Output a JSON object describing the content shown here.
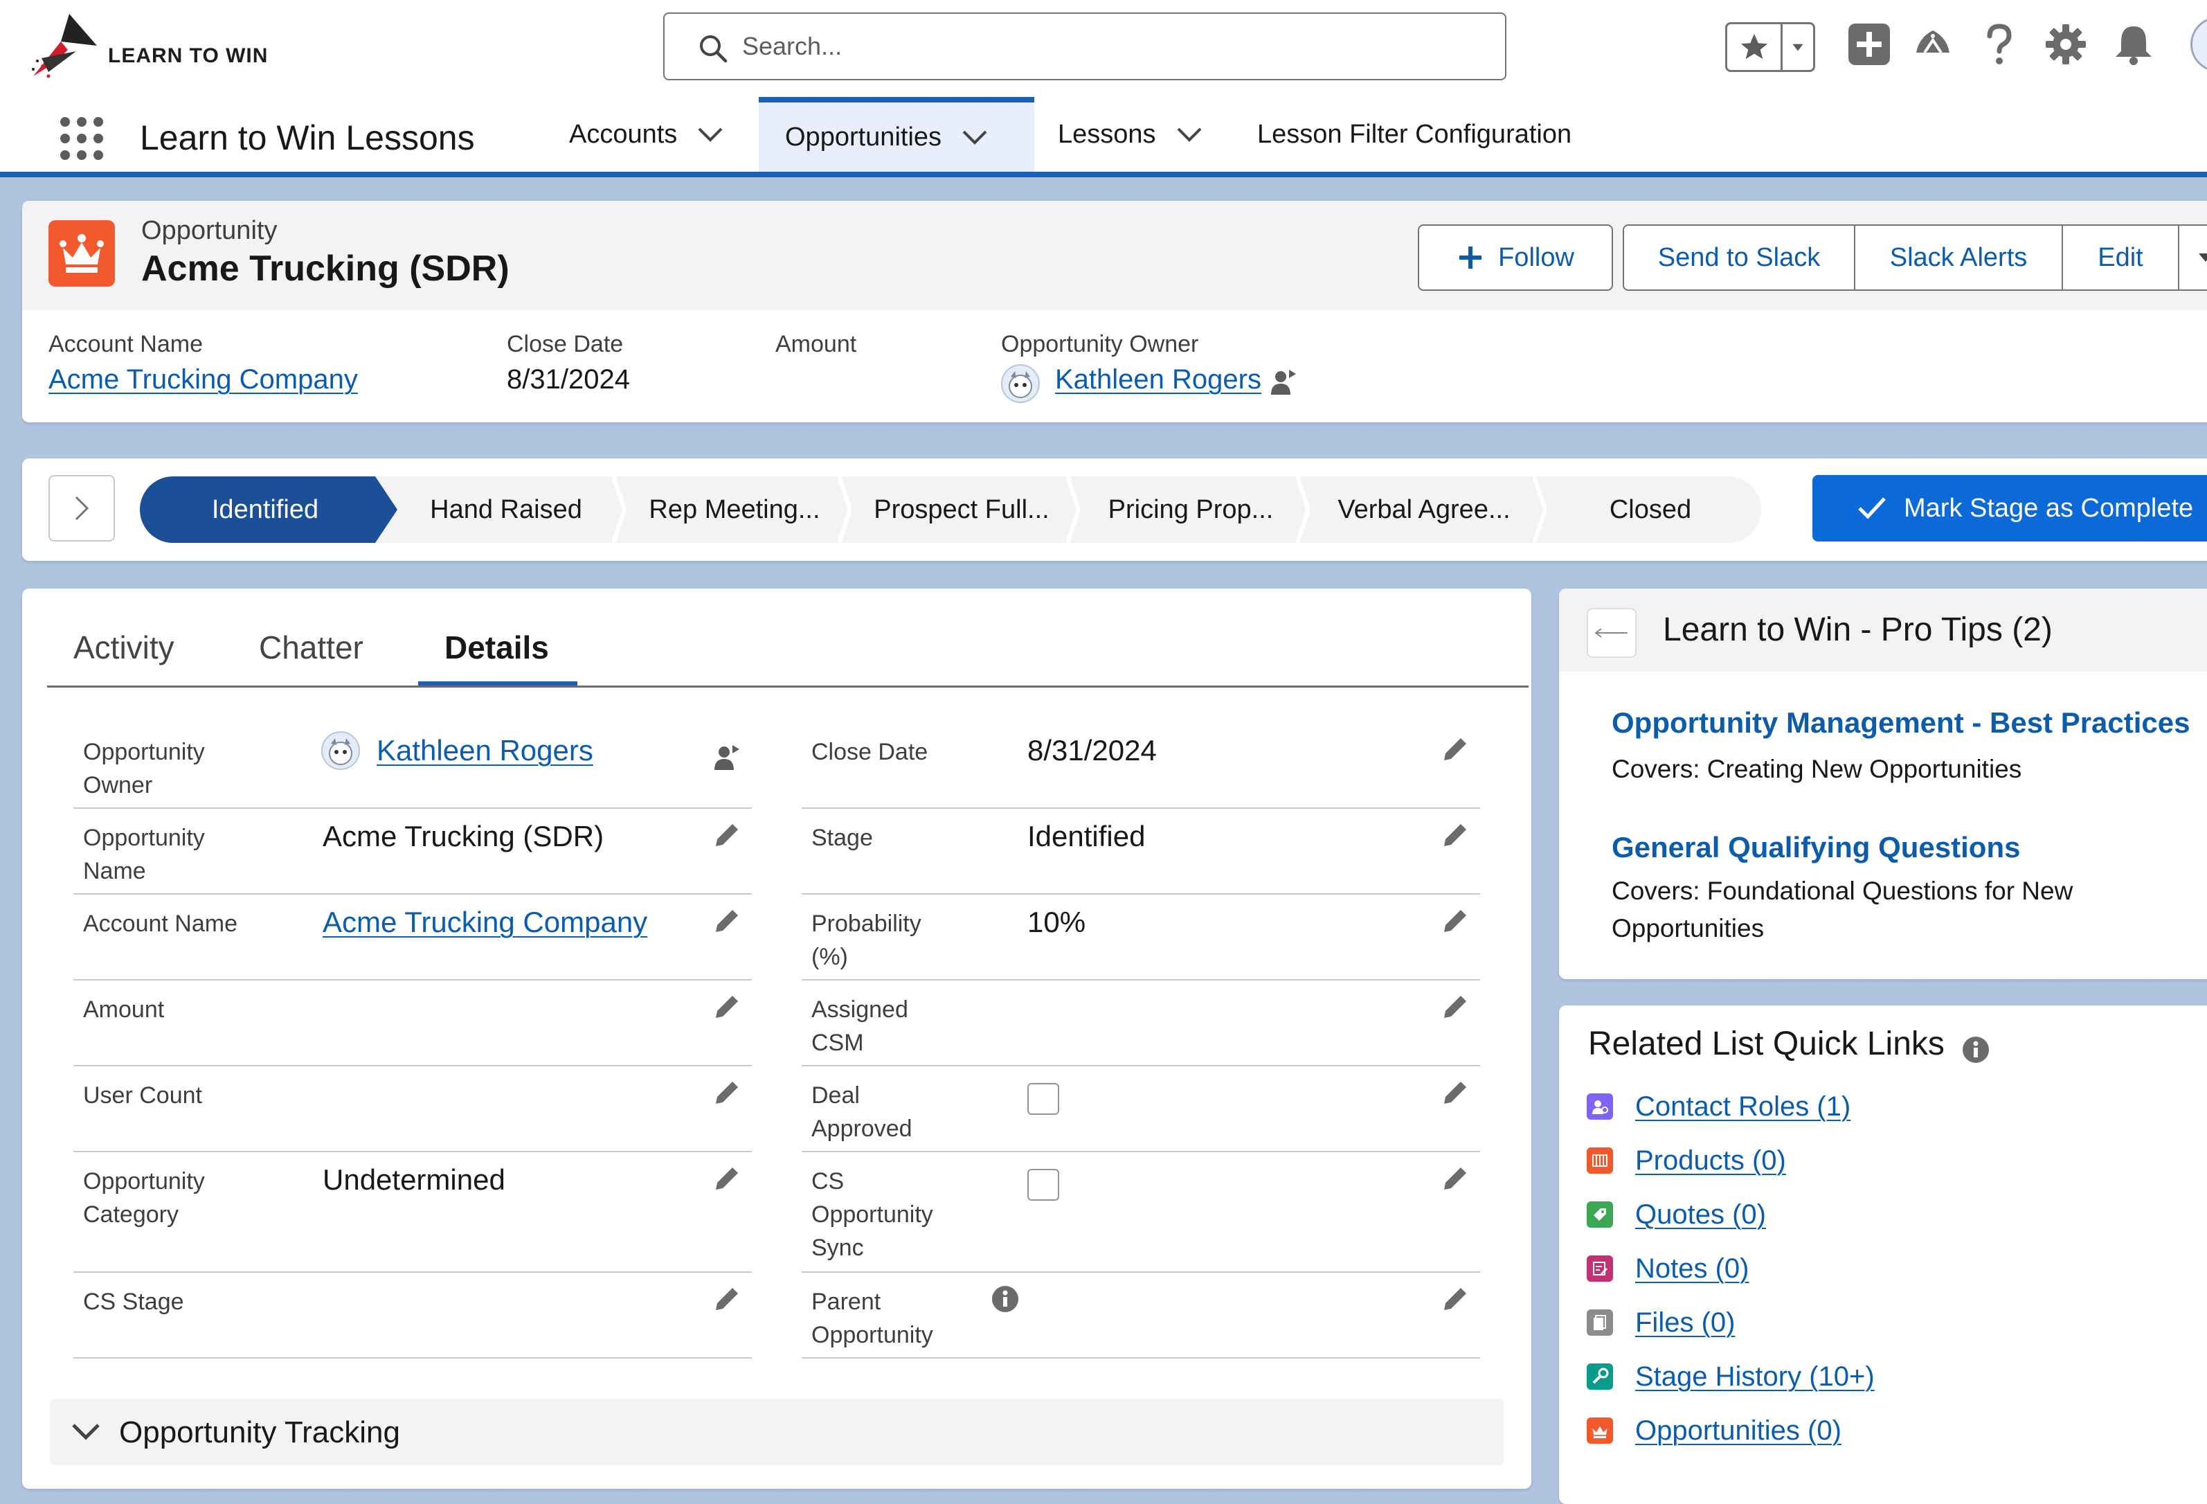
{
  "header": {
    "logo_text": "LEARN TO WIN",
    "search_placeholder": "Search...",
    "icons": [
      "star-icon",
      "chevron-down-icon",
      "add-icon",
      "trailhead-icon",
      "help-icon",
      "gear-icon",
      "bell-icon",
      "avatar"
    ]
  },
  "nav": {
    "app_name": "Learn to Win Lessons",
    "tabs": [
      {
        "label": "Accounts",
        "has_menu": true
      },
      {
        "label": "Opportunities",
        "has_menu": true,
        "active": true
      },
      {
        "label": "Lessons",
        "has_menu": true
      },
      {
        "label": "Lesson Filter Configuration",
        "has_menu": false
      }
    ]
  },
  "record": {
    "type": "Opportunity",
    "title": "Acme Trucking (SDR)",
    "actions": [
      "Follow",
      "Send to Slack",
      "Slack Alerts",
      "Edit"
    ],
    "highlights": [
      {
        "label": "Account Name",
        "value": "Acme Trucking Company",
        "link": true
      },
      {
        "label": "Close Date",
        "value": "8/31/2024"
      },
      {
        "label": "Amount",
        "value": ""
      },
      {
        "label": "Opportunity Owner",
        "value": "Kathleen Rogers",
        "link": true
      }
    ]
  },
  "path": {
    "stages": [
      "Identified",
      "Hand Raised",
      "Rep Meeting...",
      "Prospect Full...",
      "Pricing Prop...",
      "Verbal Agree...",
      "Closed"
    ],
    "current_stage": "Identified",
    "mark_complete_label": "Mark Stage as Complete"
  },
  "details": {
    "tabs": [
      "Activity",
      "Chatter",
      "Details"
    ],
    "active_tab": "Details",
    "left_fields": [
      {
        "label": "Opportunity Owner",
        "value": "Kathleen Rogers",
        "type": "user"
      },
      {
        "label": "Opportunity Name",
        "value": "Acme Trucking (SDR)"
      },
      {
        "label": "Account Name",
        "value": "Acme Trucking Company",
        "type": "link"
      },
      {
        "label": "Amount",
        "value": ""
      },
      {
        "label": "User Count",
        "value": ""
      },
      {
        "label": "Opportunity Category",
        "value": "Undetermined"
      },
      {
        "label": "CS Stage",
        "value": ""
      }
    ],
    "right_fields": [
      {
        "label": "Close Date",
        "value": "8/31/2024"
      },
      {
        "label": "Stage",
        "value": "Identified"
      },
      {
        "label": "Probability (%)",
        "value": "10%"
      },
      {
        "label": "Assigned CSM",
        "value": ""
      },
      {
        "label": "Deal Approved",
        "value": false,
        "type": "checkbox"
      },
      {
        "label": "CS Opportunity Sync",
        "value": false,
        "type": "checkbox"
      },
      {
        "label": "Parent Opportunity",
        "value": "",
        "has_info": true
      }
    ],
    "section_opportunity_tracking": "Opportunity Tracking"
  },
  "pro_tips": {
    "title": "Learn to Win - Pro Tips (2)",
    "tips": [
      {
        "title": "Opportunity Management - Best Practices",
        "desc": "Covers: Creating New Opportunities"
      },
      {
        "title": "General Qualifying Questions",
        "desc": "Covers: Foundational Questions for New Opportunities"
      }
    ]
  },
  "quick_links": {
    "title": "Related List Quick Links",
    "items": [
      {
        "label": "Contact Roles (1)",
        "color": "#7f63f4",
        "icon": "contact-roles-icon"
      },
      {
        "label": "Products (0)",
        "color": "#f2592c",
        "icon": "products-icon"
      },
      {
        "label": "Quotes (0)",
        "color": "#3ba755",
        "icon": "quotes-icon"
      },
      {
        "label": "Notes (0)",
        "color": "#c23270",
        "icon": "notes-icon"
      },
      {
        "label": "Files (0)",
        "color": "#8c8c8c",
        "icon": "files-icon"
      },
      {
        "label": "Stage History (10+)",
        "color": "#0a9c8b",
        "icon": "stage-history-icon"
      },
      {
        "label": "Opportunities (0)",
        "color": "#f2592c",
        "icon": "opportunities-icon"
      }
    ]
  },
  "colors": {
    "brand_blue": "#1b5fb6",
    "link_blue": "#0b5cab",
    "path_active": "#1b4f97",
    "opportunity_orange": "#f2592c"
  }
}
